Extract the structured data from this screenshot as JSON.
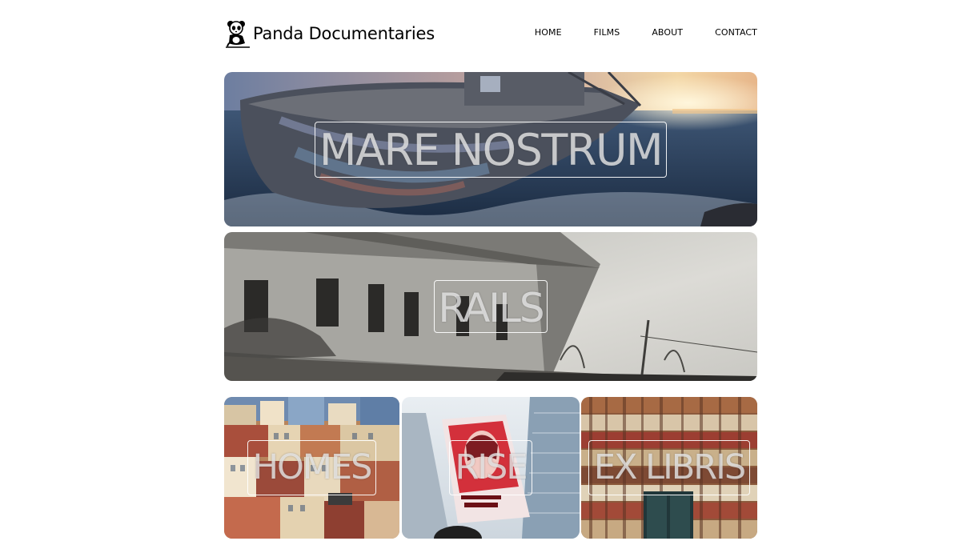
{
  "brand": {
    "name": "Panda Documentaries",
    "logo_icon": "panda-icon"
  },
  "nav": [
    {
      "label": "HOME"
    },
    {
      "label": "FILMS"
    },
    {
      "label": "ABOUT"
    },
    {
      "label": "CONTACT"
    }
  ],
  "films": [
    {
      "title": "MARE NOSTRUM",
      "image": "shipwreck-sunset-image"
    },
    {
      "title": "RAILS",
      "image": "abandoned-building-image"
    },
    {
      "title": "HOMES",
      "image": "city-rooftops-image"
    },
    {
      "title": "RISE",
      "image": "protest-sign-image"
    },
    {
      "title": "EX LIBRIS",
      "image": "bookshelves-door-image"
    }
  ]
}
